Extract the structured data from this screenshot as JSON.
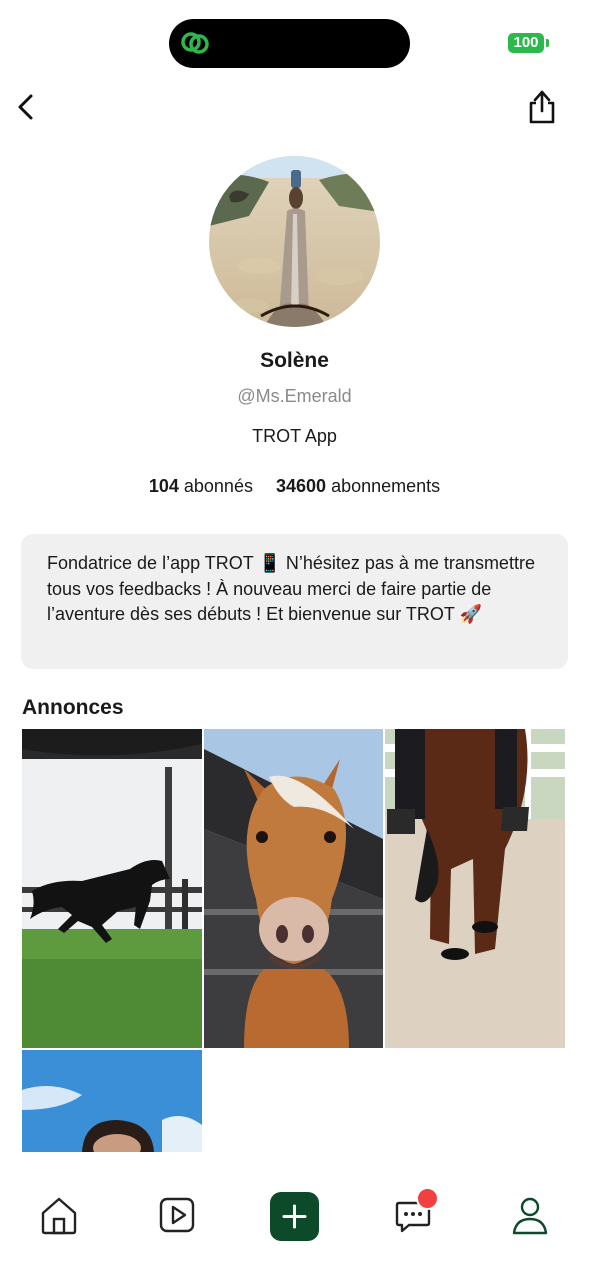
{
  "status_bar": {
    "battery": "100",
    "battery_color": "#2db84b",
    "island_app_icon": "link-icon"
  },
  "nav": {
    "back_icon": "chevron-left-icon",
    "share_icon": "share-icon"
  },
  "profile": {
    "name": "Solène",
    "handle": "@Ms.Emerald",
    "organization": "TROT App",
    "followers_count": "104",
    "followers_label": "abonnés",
    "following_count": "34600",
    "following_label": "abonnements",
    "bio": "Fondatrice de l’app TROT 📱 N’hésitez pas à me transmettre tous vos feedbacks ! À nouveau merci de faire partie de l’aventure dès ses débuts ! Et bienvenue sur TROT 🚀"
  },
  "listings": {
    "title": "Annonces"
  },
  "tab_bar": {
    "items": [
      "home-icon",
      "video-icon",
      "plus-icon",
      "chat-icon",
      "profile-icon"
    ],
    "accent_color": "#0d4a2a",
    "badge_color": "#f24040"
  }
}
